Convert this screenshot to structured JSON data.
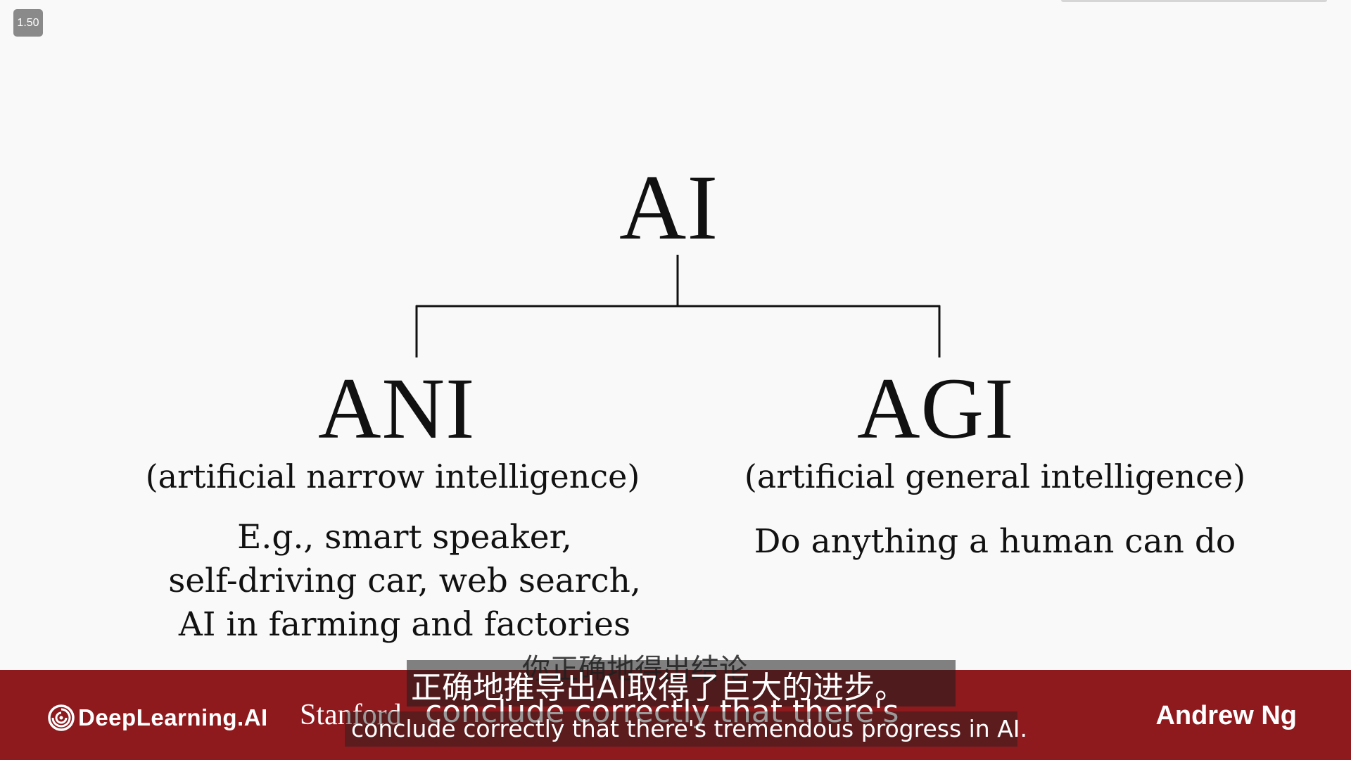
{
  "player": {
    "speed_label": "1.50"
  },
  "slide": {
    "root": {
      "title": "AI"
    },
    "left_branch": {
      "title": "ANI",
      "subtitle": "(artificial narrow intelligence)",
      "example_lines": [
        "E.g., smart speaker,",
        "self-driving car, web search,",
        "AI in farming and factories"
      ]
    },
    "right_branch": {
      "title": "AGI",
      "subtitle": "(artificial general intelligence)",
      "description": "Do anything a human can do"
    }
  },
  "banner": {
    "logo_text": "DeepLearning.AI",
    "partner_text": "Stanford",
    "presenter_name": "Andrew Ng",
    "background_color": "#8e1a1e"
  },
  "subtitles": {
    "chinese_ghost": "你正确地得出结论",
    "chinese_current": "正确地推导出AI取得了巨大的进步。",
    "english_ghost": "conclude correctly that there's",
    "english_current": "conclude correctly that there's tremendous progress in AI."
  }
}
